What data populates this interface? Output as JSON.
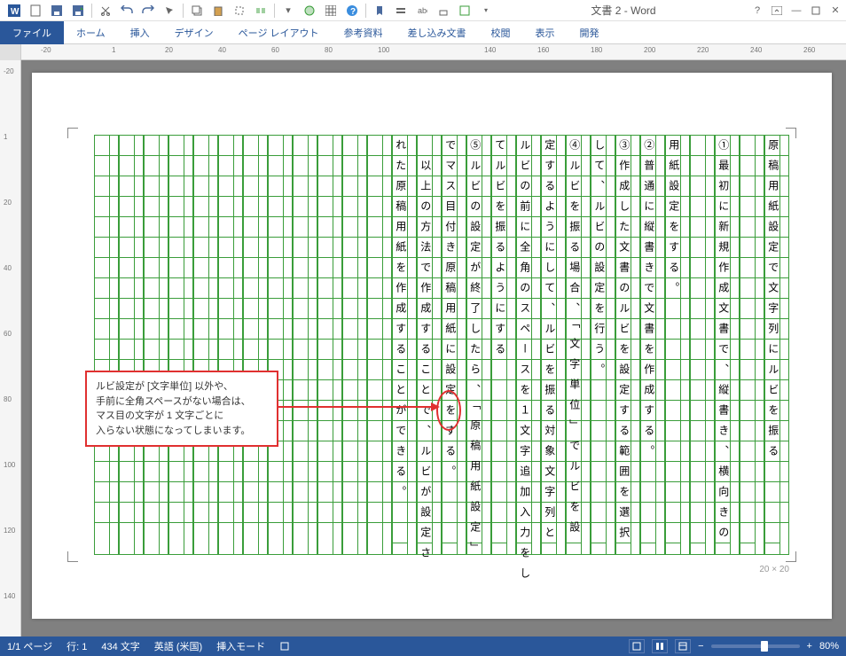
{
  "app": {
    "title": "文書 2 - Word"
  },
  "ribbon": {
    "tabs": [
      "ファイル",
      "ホーム",
      "挿入",
      "デザイン",
      "ページ レイアウト",
      "参考資料",
      "差し込み文書",
      "校閲",
      "表示",
      "開発"
    ],
    "active": 0
  },
  "ruler_h": [
    "-20",
    "1",
    "20",
    "40",
    "60",
    "80",
    "100",
    "140",
    "160",
    "180",
    "200",
    "220",
    "240",
    "260"
  ],
  "ruler_v": [
    "-20",
    "1",
    "20",
    "40",
    "60",
    "80",
    "100",
    "120",
    "140"
  ],
  "callout": {
    "lines": [
      "ルビ設定が [文字単位] 以外や、",
      "手前に全角スペースがない場合は、",
      "マス目の文字が 1 文字ごとに",
      "入らない状態になってしまいます。"
    ]
  },
  "columns": [
    "原稿用紙設定で文字列にルビを振る",
    "",
    "①最初に新規作成文書で、縦書き、横向きの",
    "",
    "用紙設定をする。",
    "②普通に縦書きで文書を作成する。",
    "③作成した文書のルビを設定する範囲を選択",
    "して、ルビの設定を行う。",
    "④ルビを振る場合、「文字単位」でルビを設",
    "定するようにして、ルビを振る対象文字列と",
    "ルビの前に全角のスペースを１文字追加入力をし",
    "てルビを振るようにする",
    "⑤ルビの設定が終了したら、「原稿用紙設定」",
    "でマス目付き原稿用紙に設定をする。",
    "　以上の方法で作成することで、ルビが設定さ",
    "れた原稿用紙を作成することができる。"
  ],
  "page_dim": "20 × 20",
  "status": {
    "page": "1/1 ページ",
    "line": "行: 1",
    "chars": "434 文字",
    "lang": "英語 (米国)",
    "mode": "挿入モード",
    "zoom": "80%",
    "zoom_minus": "−",
    "zoom_plus": "+"
  }
}
